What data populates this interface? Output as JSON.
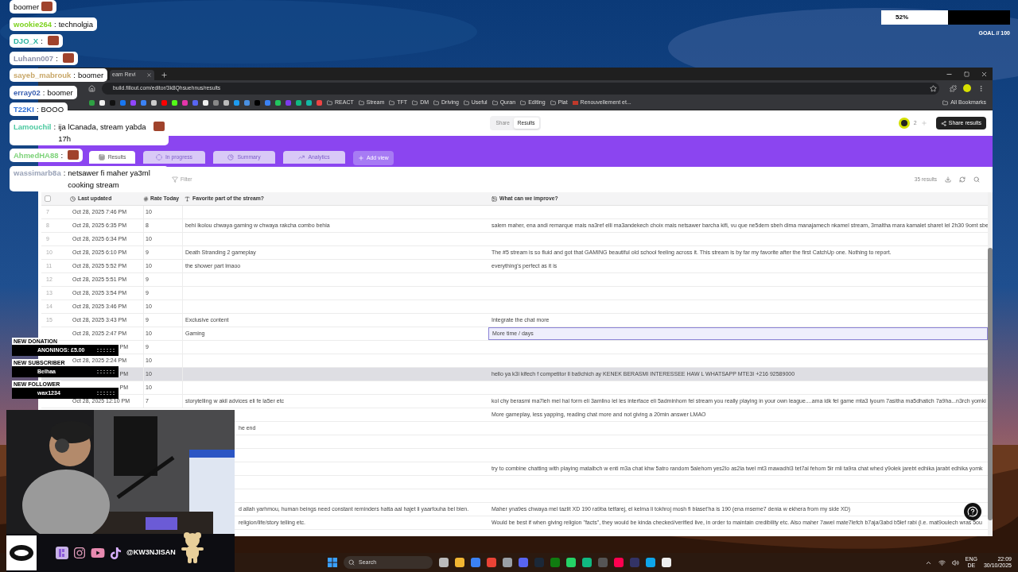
{
  "goal": {
    "reading": "52%",
    "level": 0.52,
    "label": "GOAL // 100"
  },
  "browser": {
    "tab_title": "eam Revi",
    "url": "build.fillout.com/editor/3k8Qhsuehnus/results",
    "bookmark_icons": [
      {
        "color": "#2ea043"
      },
      {
        "color": "#f0f0f0"
      },
      {
        "color": "#111111"
      },
      {
        "color": "#1877f2"
      },
      {
        "color": "#9146ff"
      },
      {
        "color": "#3b82f6"
      },
      {
        "color": "#cccccc"
      },
      {
        "color": "#ff0000"
      },
      {
        "color": "#53fc18"
      },
      {
        "color": "#e535ab"
      },
      {
        "color": "#5865f2"
      },
      {
        "color": "#f0f0f0"
      },
      {
        "color": "#888888"
      },
      {
        "color": "#bbbbbb"
      },
      {
        "color": "#1d9bf0"
      },
      {
        "color": "#4a90e2"
      },
      {
        "color": "#000000"
      },
      {
        "color": "#3b82f6"
      },
      {
        "color": "#22c55e"
      },
      {
        "color": "#7c3aed"
      },
      {
        "color": "#10b981"
      },
      {
        "color": "#14b8a6"
      },
      {
        "color": "#ef4444"
      }
    ],
    "bookmark_folders": [
      "REACT",
      "Stream",
      "TFT",
      "DM",
      "Driving",
      "Useful",
      "Quran",
      "Editing",
      "Plat"
    ],
    "bookmark_link": "Renouvellement et...",
    "all_bookmarks": "All Bookmarks"
  },
  "app": {
    "toggle": [
      {
        "label": "Share",
        "selected": false
      },
      {
        "label": "Results",
        "selected": true
      }
    ],
    "collaborators": "2",
    "share_button": "Share results",
    "views": [
      {
        "label": "Results",
        "selected": true
      },
      {
        "label": "In progress",
        "selected": false
      },
      {
        "label": "Summary",
        "selected": false
      },
      {
        "label": "Analytics",
        "selected": false
      }
    ],
    "all_selected": false,
    "add_view": "Add view",
    "filter": "Filter",
    "result_count": "35 results",
    "columns": [
      "Last updated",
      "Rate Today",
      "Favorite part of the stream?",
      "What can we improve?"
    ],
    "rows": [
      {
        "kind": "full",
        "num": "7",
        "date": "Oct 28, 2025 7:46 PM",
        "rate": "10",
        "hovered": false,
        "improve_selected": false
      },
      {
        "kind": "full",
        "num": "8",
        "date": "Oct 28, 2025 6:35 PM",
        "rate": "8",
        "favorite": "behi lkolou chwaya gaming w chwaya rakcha combo behia",
        "improve": "salem maher, ena andi remarque mais na3ref elli ma3andekech choix mais netsawer barcha kifi, vu que ne5dem sbeh dima manajamech nkamel stream, 3maltha mara kamalet sharet lel 2h30 9omt sbe",
        "hovered": false,
        "improve_selected": false
      },
      {
        "kind": "full",
        "num": "9",
        "date": "Oct 28, 2025 6:34 PM",
        "rate": "10",
        "hovered": false,
        "improve_selected": false
      },
      {
        "kind": "full",
        "num": "10",
        "date": "Oct 28, 2025 6:10 PM",
        "rate": "9",
        "favorite": "Death Stranding 2 gameplay",
        "improve": "The #5 stream is so fluid and got that GAMING beautiful old school feeling across it. This stream is by far my favorite after the first CatchUp one. Nothing to report.",
        "hovered": false,
        "improve_selected": false
      },
      {
        "kind": "full",
        "num": "11",
        "date": "Oct 28, 2025 5:52 PM",
        "rate": "10",
        "favorite": "the shower part lmaoo",
        "improve": "everything's perfect as it is",
        "hovered": false,
        "improve_selected": false
      },
      {
        "kind": "full",
        "num": "12",
        "date": "Oct 28, 2025 5:51 PM",
        "rate": "9",
        "hovered": false,
        "improve_selected": false
      },
      {
        "kind": "full",
        "num": "13",
        "date": "Oct 28, 2025 3:54 PM",
        "rate": "9",
        "hovered": false,
        "improve_selected": false
      },
      {
        "kind": "full",
        "num": "14",
        "date": "Oct 28, 2025 3:46 PM",
        "rate": "10",
        "hovered": false,
        "improve_selected": false
      },
      {
        "kind": "full",
        "num": "15",
        "date": "Oct 28, 2025 3:43 PM",
        "rate": "9",
        "favorite": "Exclusive content",
        "improve": "Integrate the chat more",
        "hovered": false,
        "improve_selected": false
      },
      {
        "kind": "full",
        "date": "Oct 28, 2025 2:47 PM",
        "rate": "10",
        "favorite": "Gaming",
        "improve": "More time / days",
        "hovered": false,
        "improve_selected": true
      },
      {
        "kind": "tail",
        "date": "PM",
        "rate": "9",
        "hovered": false,
        "improve_selected": false
      },
      {
        "kind": "full",
        "date": "Oct 28, 2025 2:24 PM",
        "rate": "10",
        "hovered": false,
        "improve_selected": false
      },
      {
        "kind": "tail",
        "date": "PM",
        "rate": "10",
        "improve": "hello ya k3i  kifech f competitor ll ba9chich ay  KENEK BERASMI INTERESSEE HAW L WHATSAPP MTE3I +216 92589000",
        "hovered": true,
        "improve_selected": false
      },
      {
        "kind": "tail",
        "date": "PM",
        "rate": "10",
        "hovered": false,
        "improve_selected": false
      },
      {
        "kind": "full",
        "date": "Oct 28, 2025 12:10 PM",
        "rate": "7",
        "favorite": "storytelling w akil advices eli fe la5er etc",
        "improve": "kol chy berasmi ma7leh mel hal form eli 3amlino lel les interface eli 5adminhom fel stream you really playing in your own league....ama idk fel game mta3 lyoum 7asitha ma5dhatich 7a9ha...n3rch yomki",
        "hovered": false,
        "improve_selected": false
      },
      {
        "kind": "hidden",
        "improve": "More gameplay, less yapping, reading chat more and not giving a 20min answer LMAO",
        "hovered": false,
        "improve_selected": false
      },
      {
        "kind": "hidden",
        "favorite": "he end",
        "hovered": false,
        "improve_selected": false
      },
      {
        "kind": "hidden",
        "hovered": false,
        "improve_selected": false
      },
      {
        "kind": "hidden",
        "hovered": false,
        "improve_selected": false
      },
      {
        "kind": "hidden",
        "improve": "try to combine chatting with playing matalbch w enti m3a chat khw 5atro random 5alehom yes2lo as2la twel mt3 mawadhi3 tet7al fehom 5ir mli ta9ra chat whed y9olek jarebt edhika jarabt edhika yomk",
        "hovered": false,
        "improve_selected": false
      },
      {
        "kind": "hidden",
        "hovered": false,
        "improve_selected": false
      },
      {
        "kind": "hidden",
        "hovered": false,
        "improve_selected": false
      },
      {
        "kind": "hidden",
        "favorite": "d allah yarhmou, human beings need constant reminders hatta aal hajet li yaarfouha bel bien.",
        "improve": "Maher yna9es chwaya mel tazlit XD 190 ra9ba tetfarej, el kelma li tokhroj mosh fi blaset'ha is 190 (ena mseme7 denia w ekhera from my side XD)",
        "hovered": false,
        "improve_selected": false
      },
      {
        "kind": "hidden",
        "favorite": "religion/life/story telling etc.",
        "improve": "Would be best if when giving religion \"facts\", they would be kinda checked/verified live, in order to maintain credibility etc. Also maher 7awel mate7lefch b7aja/3abd b5lef rabi (i.e. mat9oulech wras 5ou",
        "hovered": false,
        "improve_selected": false
      }
    ]
  },
  "chat": [
    {
      "text": "boomer",
      "emote": true
    },
    {
      "user": "wookie264",
      "sep": ":",
      "color": "#7ed321",
      "text": "technolgia",
      "emote": false
    },
    {
      "user": "DJO_X",
      "sep": ":",
      "color": "#2bb3a0",
      "emote": true
    },
    {
      "user": "Luhann007",
      "sep": ":",
      "color": "#8a8fa8",
      "emote": true
    },
    {
      "user": "sayeb_mabrouk",
      "sep": ":",
      "color": "#c9a86a",
      "text": "boomer",
      "emote": false
    },
    {
      "user": "erray02",
      "sep": ":",
      "color": "#3a5fb0",
      "text": "boomer",
      "emote": false
    },
    {
      "user": "T22KI",
      "sep": ":",
      "color": "#2d6fd8",
      "text": "BOOO",
      "emote": false
    },
    {
      "user": "Lamouchil",
      "sep": ":",
      "color": "#4cc9a0",
      "text": "ija lCanada, stream yabda 17h",
      "emote": true
    },
    {
      "user": "AhmedHA88",
      "sep": ":",
      "color": "#7ed37a",
      "emote": true
    },
    {
      "user": "wassimarb8a",
      "sep": ":",
      "color": "#9aa3b8",
      "text": "netsawer fi maher ya3ml cooking stream",
      "emote": false
    }
  ],
  "alerts": [
    {
      "label": "NEW DONATION",
      "value": "ANONINOS: £5.00"
    },
    {
      "label": "NEW SUBSCRIBER",
      "value": "Belhaa"
    },
    {
      "label": "NEW FOLLOWER",
      "value": "wax1234"
    }
  ],
  "overlay": {
    "handle": "@KW3NJISAN"
  },
  "taskbar": {
    "search": "Search",
    "apps": [
      {
        "color": "#bbbbbb"
      },
      {
        "color": "#f2b632"
      },
      {
        "color": "#3b82f6"
      },
      {
        "color": "#ea4335"
      },
      {
        "color": "#9aa0a6"
      },
      {
        "color": "#5865f2"
      },
      {
        "color": "#1b2838"
      },
      {
        "color": "#107c10"
      },
      {
        "color": "#25d366"
      },
      {
        "color": "#10b981"
      },
      {
        "color": "#555555"
      },
      {
        "color": "#ff0050"
      },
      {
        "color": "#333366"
      },
      {
        "color": "#0ea5e9"
      },
      {
        "color": "#eeeeee"
      }
    ],
    "language": "ENG",
    "layout": "DE",
    "time": "22:09",
    "date": "30/10/2025"
  }
}
